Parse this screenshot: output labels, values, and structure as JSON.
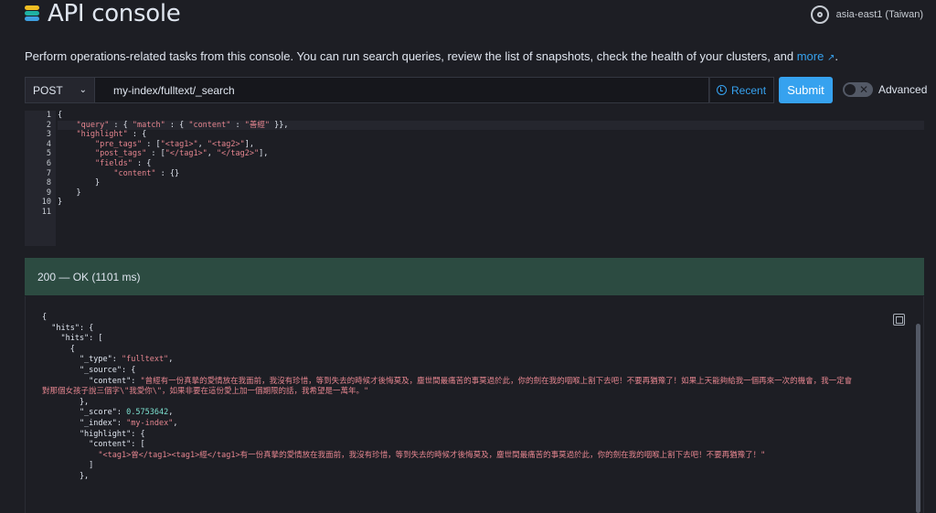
{
  "header": {
    "title": "API console",
    "region": "asia-east1 (Taiwan)"
  },
  "description": {
    "text": "Perform operations-related tasks from this console. You can run search queries, review the list of snapshots, check the health of your clusters, and ",
    "link": "more",
    "suffix": "."
  },
  "request": {
    "method": "POST",
    "path": "my-index/fulltext/_search",
    "recent_label": "Recent",
    "submit_label": "Submit",
    "advanced_label": "Advanced"
  },
  "editor": {
    "line_numbers": [
      "1",
      "2",
      "3",
      "4",
      "5",
      "6",
      "7",
      "8",
      "9",
      "10",
      "11"
    ],
    "lines": [
      "{",
      "    \"query\" : { \"match\" : { \"content\" : \"善經\" }},",
      "    \"highlight\" : {",
      "        \"pre_tags\" : [\"<tag1>\", \"<tag2>\"],",
      "        \"post_tags\" : [\"</tag1>\", \"</tag2>\"],",
      "        \"fields\" : {",
      "            \"content\" : {}",
      "        }",
      "    }",
      "}",
      ""
    ]
  },
  "response": {
    "status": "200 — OK (1101 ms)",
    "lines": [
      "{",
      "  \"hits\": {",
      "    \"hits\": [",
      "      {",
      "        \"_type\": \"fulltext\",",
      "        \"_source\": {",
      "          \"content\": \"曾經有一份真摯的愛情放在我面前，我沒有珍惜，等到失去的時候才後悔莫及，塵世間最痛苦的事莫過於此，你的劍在我的咽喉上割下去吧！不要再猶豫了！如果上天能夠給我一個再來一次的機會，我一定會",
      "對那個女孩子說三個字\\\"我愛你\\\"，如果非要在這份愛上加一個期限的話，我希望是一萬年。\"",
      "        },",
      "        \"_score\": 0.5753642,",
      "        \"_index\": \"my-index\",",
      "        \"highlight\": {",
      "          \"content\": [",
      "            \"<tag1>曾</tag1><tag1>經</tag1>有一份真摯的愛情放在我面前，我沒有珍惜，等到失去的時候才後悔莫及，塵世間最痛苦的事莫過於此，你的劍在我的咽喉上割下去吧！不要再猶豫了！\"",
      "          ]",
      "        },"
    ]
  },
  "colors": {
    "accent": "#36a2ef",
    "success_bg": "#2c4b41",
    "string": "#e5858f",
    "number": "#7de2d1"
  }
}
